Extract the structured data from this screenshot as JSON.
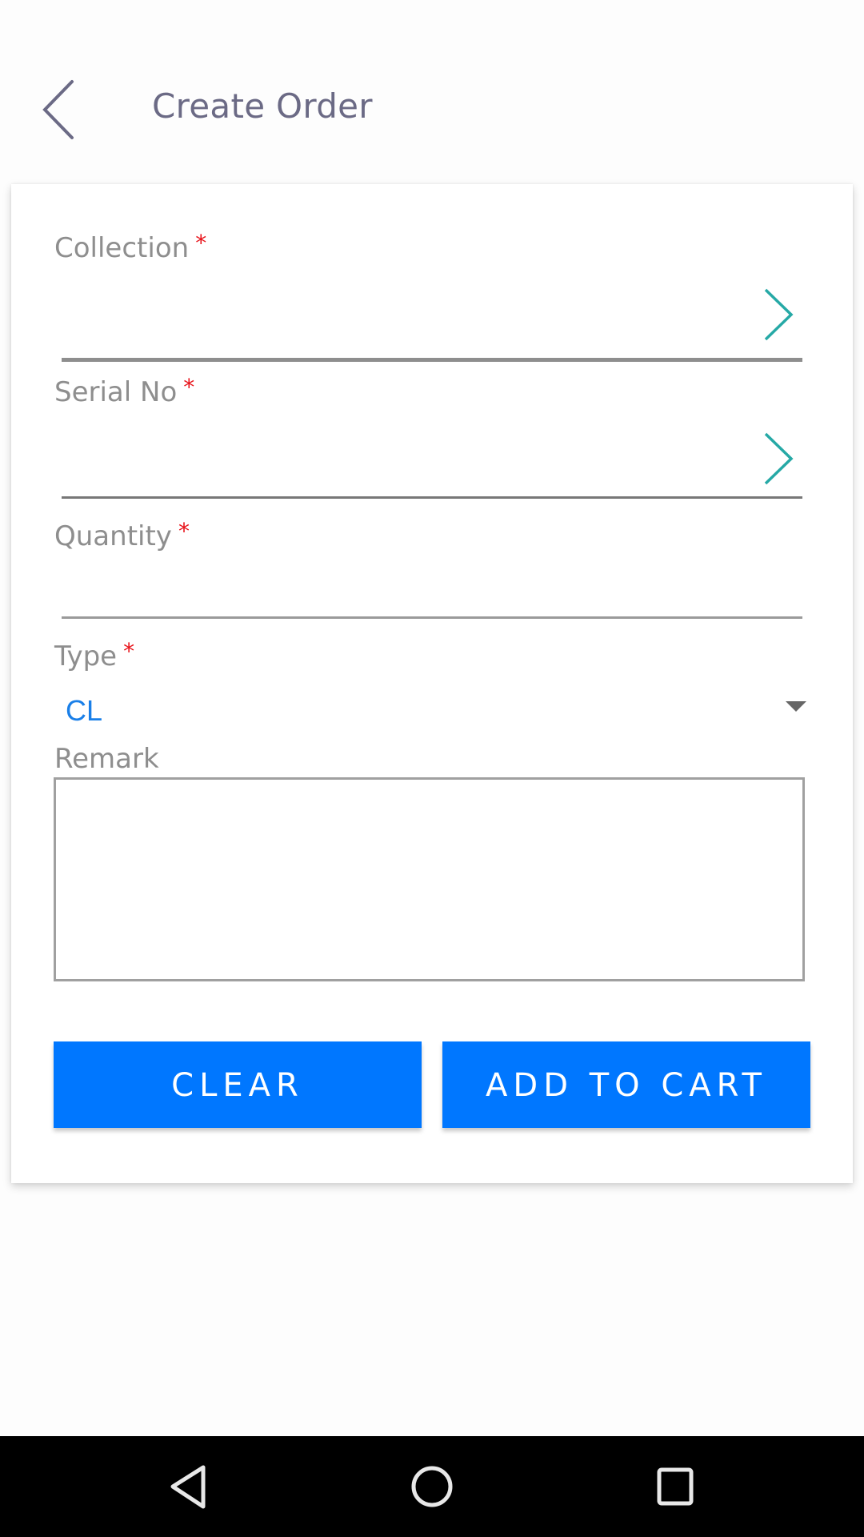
{
  "header": {
    "title": "Create Order",
    "back_icon": "chevron-left-icon"
  },
  "form": {
    "collection": {
      "label": "Collection",
      "required_mark": "*",
      "value": "",
      "icon": "chevron-right-icon"
    },
    "serial_no": {
      "label": "Serial No",
      "required_mark": "*",
      "value": "",
      "icon": "chevron-right-icon"
    },
    "quantity": {
      "label": "Quantity",
      "required_mark": "*",
      "value": ""
    },
    "type": {
      "label": "Type",
      "required_mark": "*",
      "selected": "CL",
      "icon": "dropdown-arrow-icon"
    },
    "remark": {
      "label": "Remark",
      "value": ""
    }
  },
  "actions": {
    "clear_label": "CLEAR",
    "add_to_cart_label": "ADD TO CART"
  },
  "system_nav": {
    "back": "nav-back-icon",
    "home": "nav-home-icon",
    "recents": "nav-recents-icon"
  },
  "colors": {
    "primary": "#0077ff",
    "accent_teal": "#26a9a6",
    "required": "#e8141b",
    "title": "#6b6a85",
    "label": "#8e8e8e",
    "selected_value": "#1a7fe8"
  }
}
